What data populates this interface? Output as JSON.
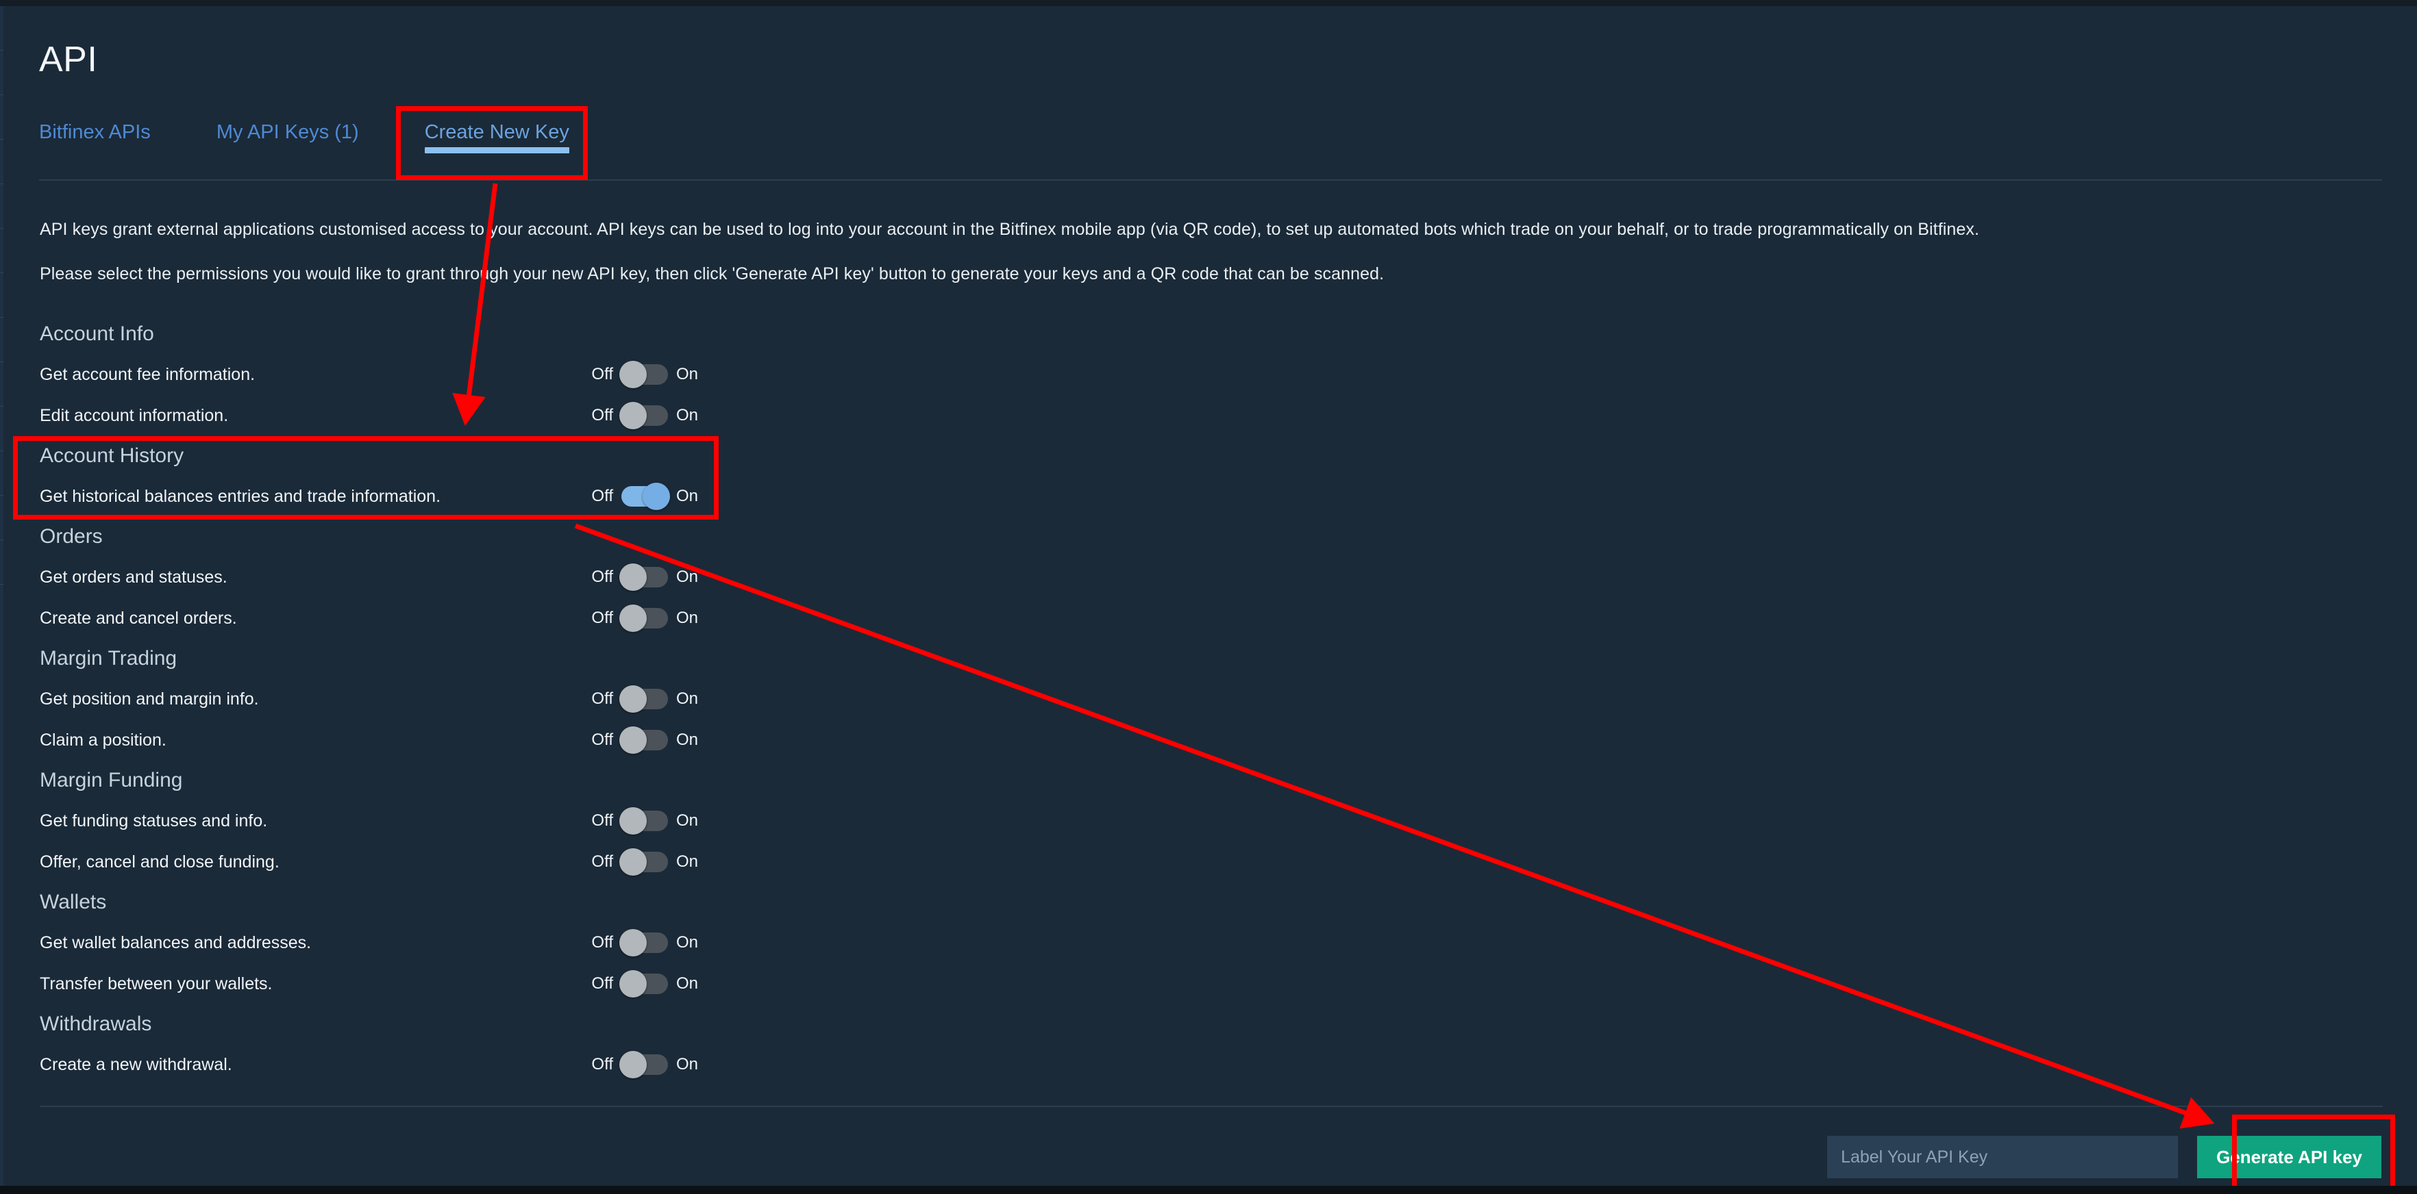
{
  "page": {
    "title": "API"
  },
  "tabs": [
    {
      "label": "Bitfinex APIs",
      "active": false
    },
    {
      "label": "My API Keys (1)",
      "active": false
    },
    {
      "label": "Create New Key",
      "active": true
    }
  ],
  "intro": {
    "paragraph1": "API keys grant external applications customised access to your account. API keys can be used to log into your account in the Bitfinex mobile app (via QR code), to set up automated bots which trade on your behalf, or to trade programmatically on Bitfinex.",
    "paragraph2": "Please select the permissions you would like to grant through your new API key, then click 'Generate API key' button to generate your keys and a QR code that can be scanned."
  },
  "toggle_labels": {
    "off": "Off",
    "on": "On"
  },
  "permission_sections": [
    {
      "title": "Account Info",
      "items": [
        {
          "label": "Get account fee information.",
          "state": "off"
        },
        {
          "label": "Edit account information.",
          "state": "off"
        }
      ]
    },
    {
      "title": "Account History",
      "items": [
        {
          "label": "Get historical balances entries and trade information.",
          "state": "on"
        }
      ]
    },
    {
      "title": "Orders",
      "items": [
        {
          "label": "Get orders and statuses.",
          "state": "off"
        },
        {
          "label": "Create and cancel orders.",
          "state": "off"
        }
      ]
    },
    {
      "title": "Margin Trading",
      "items": [
        {
          "label": "Get position and margin info.",
          "state": "off"
        },
        {
          "label": "Claim a position.",
          "state": "off"
        }
      ]
    },
    {
      "title": "Margin Funding",
      "items": [
        {
          "label": "Get funding statuses and info.",
          "state": "off"
        },
        {
          "label": "Offer, cancel and close funding.",
          "state": "off"
        }
      ]
    },
    {
      "title": "Wallets",
      "items": [
        {
          "label": "Get wallet balances and addresses.",
          "state": "off"
        },
        {
          "label": "Transfer between your wallets.",
          "state": "off"
        }
      ]
    },
    {
      "title": "Withdrawals",
      "items": [
        {
          "label": "Create a new withdrawal.",
          "state": "off"
        }
      ]
    }
  ],
  "footer": {
    "api_label_placeholder": "Label Your API Key",
    "api_label_value": "",
    "generate_button": "Generate API key"
  },
  "colors": {
    "background": "#1b2a38",
    "accent_link": "#4d8ad6",
    "tab_underline": "#8cc0f0",
    "toggle_on": "#7fb6e8",
    "toggle_off_track": "#4b5259",
    "toggle_off_knob": "#b2b7bb",
    "generate_button": "#0fa47f",
    "annotation": "#ff0000",
    "input_background": "#2a4055"
  },
  "annotations": {
    "highlight_boxes": [
      "create-new-key-tab",
      "account-history-section",
      "generate-api-key-button"
    ],
    "arrows": [
      "create-new-key-tab-to-account-history",
      "account-history-to-generate-api-key-button"
    ]
  }
}
